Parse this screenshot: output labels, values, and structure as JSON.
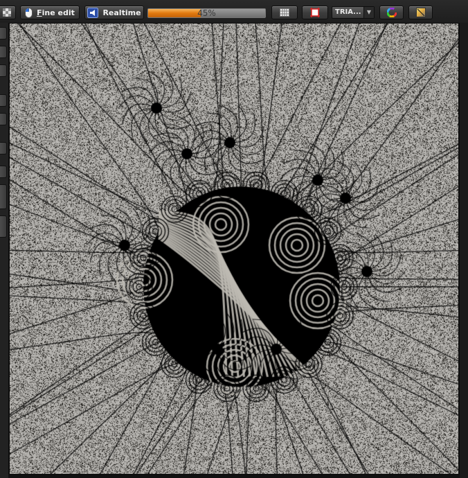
{
  "toolbar": {
    "fine_edit_label_hotkey": "F",
    "fine_edit_label_rest": "ine edit",
    "realtime_label": "Realtime",
    "progress": {
      "value": 0.45,
      "label": "45%"
    },
    "render_mode": {
      "selected": "TRIA..."
    }
  },
  "icons": {
    "left_button": "checkerboard-icon",
    "fine_edit": "mouse-icon",
    "realtime": "speaker-icon",
    "grid": "grid-icon",
    "crop": "crop-frame-icon",
    "colors": "color-wheel-icon",
    "gradient": "gradient-icon"
  },
  "colors": {
    "accent": "#e27a10",
    "background": "#ada9a2",
    "ink": "#000000"
  },
  "canvas": {
    "image": "fractal-field-lines-render"
  }
}
